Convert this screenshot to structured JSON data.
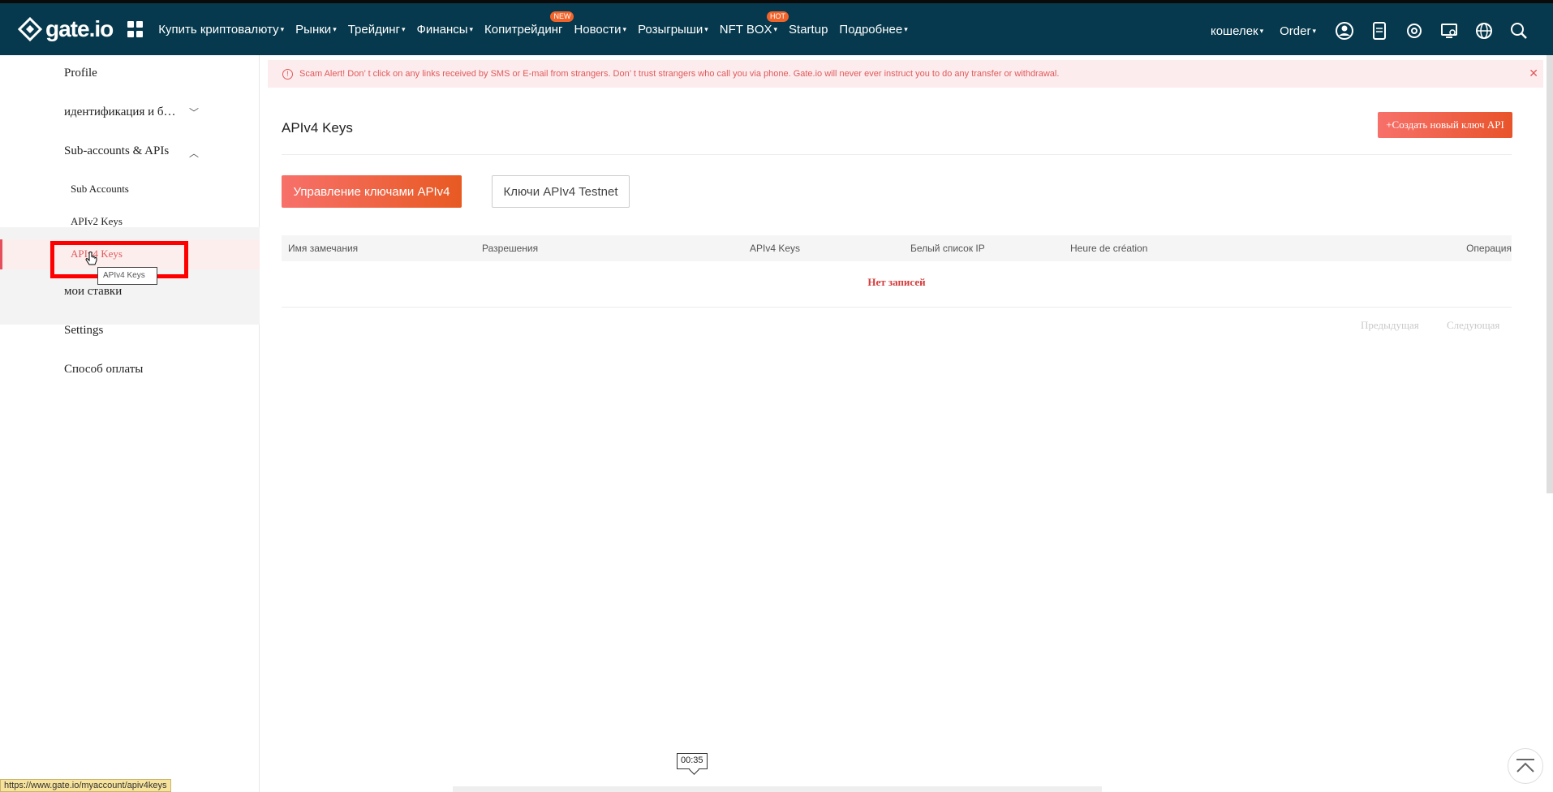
{
  "header": {
    "logo_text": "gate.io",
    "nav": [
      {
        "label": "Купить криптовалюту",
        "caret": true
      },
      {
        "label": "Рынки",
        "caret": true
      },
      {
        "label": "Трейдинг",
        "caret": true
      },
      {
        "label": "Финансы",
        "caret": true
      },
      {
        "label": "Копитрейдинг",
        "caret": false,
        "badge": "NEW"
      },
      {
        "label": "Новости",
        "caret": true
      },
      {
        "label": "Розыгрыши",
        "caret": true
      },
      {
        "label": "NFT BOX",
        "caret": true,
        "badge": "HOT"
      },
      {
        "label": "Startup",
        "caret": false
      },
      {
        "label": "Подробнее",
        "caret": true
      }
    ],
    "right": {
      "wallet": "кошелек",
      "order": "Order"
    },
    "icons": [
      "user-icon",
      "app-download-icon",
      "support-icon",
      "settings-icon",
      "globe-icon",
      "search-icon"
    ],
    "colors": {
      "bar": "#06394d",
      "accent": "#e8542a",
      "badge": "#f0642c"
    }
  },
  "sidebar": {
    "profile": "Profile",
    "identification": "идентификация и б…",
    "subaccounts": "Sub-accounts & APIs",
    "sub_items": [
      "Sub Accounts",
      "APIv2 Keys",
      "APIv4 Keys"
    ],
    "bets": "мои ставки",
    "settings": "Settings",
    "payment": "Способ оплаты",
    "tooltip": "APIv4 Keys"
  },
  "status_url": "https://www.gate.io/myaccount/apiv4keys",
  "main": {
    "alert": "Scam Alert! Don’ t click on any links received by SMS or E-mail from strangers. Don’ t trust strangers who call you via phone. Gate.io will never ever instruct you to do any transfer or withdrawal.",
    "title": "APIv4 Keys",
    "create_button": "+Создать новый ключ API",
    "tab_manage": "Управление ключами APIv4",
    "tab_testnet": "Ключи APIv4 Testnet",
    "columns": [
      "Имя замечания",
      "Разрешения",
      "APIv4 Keys",
      "Белый список IP",
      "Heure de création",
      "Операция"
    ],
    "empty": "Нет записей",
    "prev": "Предыдущая",
    "next": "Следующая"
  },
  "timer": "00:35"
}
